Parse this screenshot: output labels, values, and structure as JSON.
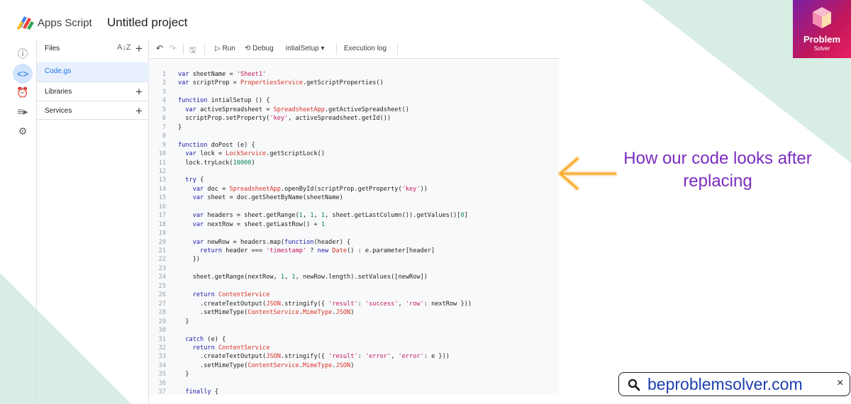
{
  "app": {
    "brand": "Apps Script",
    "project_title": "Untitled project"
  },
  "rail": {
    "icons": [
      "info-icon",
      "code-icon",
      "alarm-clock-icon",
      "executions-icon",
      "gear-icon"
    ],
    "glyphs": [
      "ⓘ",
      "<>",
      "⏰",
      "≡▸",
      "⚙"
    ]
  },
  "files_panel": {
    "title": "Files",
    "sort_glyph": "A͏Z",
    "add_glyph": "+",
    "current_file": "Code.gs",
    "sections": [
      "Libraries",
      "Services"
    ]
  },
  "toolbar": {
    "undo": "↶",
    "redo": "↷",
    "save": "🖫",
    "run": "▷ Run",
    "debug": "⟲ Debug",
    "function_select": "intialSetup",
    "execution_log": "Execution log"
  },
  "code": [
    {
      "n": "1",
      "html": "<span class=\"kw\">var</span> sheetName = <span class=\"str\">'Sheet1'</span>"
    },
    {
      "n": "2",
      "html": "<span class=\"kw\">var</span> scriptProp = <span class=\"cls\">PropertiesService</span>.getScriptProperties()"
    },
    {
      "n": "3",
      "html": ""
    },
    {
      "n": "4",
      "html": "<span class=\"kw\">function</span> intialSetup () {"
    },
    {
      "n": "5",
      "html": "  <span class=\"kw\">var</span> activeSpreadsheet = <span class=\"cls\">SpreadsheetApp</span>.getActiveSpreadsheet()"
    },
    {
      "n": "6",
      "html": "  scriptProp.setProperty(<span class=\"str\">'key'</span>, activeSpreadsheet.getId())"
    },
    {
      "n": "7",
      "html": "}"
    },
    {
      "n": "8",
      "html": ""
    },
    {
      "n": "9",
      "html": "<span class=\"kw\">function</span> doPost (e) {"
    },
    {
      "n": "10",
      "html": "  <span class=\"kw\">var</span> lock = <span class=\"cls\">LockService</span>.getScriptLock()"
    },
    {
      "n": "11",
      "html": "  lock.tryLock(<span class=\"num\">10000</span>)"
    },
    {
      "n": "12",
      "html": ""
    },
    {
      "n": "13",
      "html": "  <span class=\"kw\">try</span> {"
    },
    {
      "n": "14",
      "html": "    <span class=\"kw\">var</span> doc = <span class=\"cls\">SpreadsheetApp</span>.openById(scriptProp.getProperty(<span class=\"str\">'key'</span>))"
    },
    {
      "n": "15",
      "html": "    <span class=\"kw\">var</span> sheet = doc.getSheetByName(sheetName)"
    },
    {
      "n": "16",
      "html": ""
    },
    {
      "n": "17",
      "html": "    <span class=\"kw\">var</span> headers = sheet.getRange(<span class=\"num\">1</span>, <span class=\"num\">1</span>, <span class=\"num\">1</span>, sheet.getLastColumn()).getValues()[<span class=\"num\">0</span>]"
    },
    {
      "n": "18",
      "html": "    <span class=\"kw\">var</span> nextRow = sheet.getLastRow() + <span class=\"num\">1</span>"
    },
    {
      "n": "19",
      "html": ""
    },
    {
      "n": "20",
      "html": "    <span class=\"kw\">var</span> newRow = headers.map(<span class=\"kw\">function</span>(header) {"
    },
    {
      "n": "21",
      "html": "      <span class=\"kw\">return</span> header === <span class=\"str\">'timestamp'</span> ? <span class=\"kw\">new</span> <span class=\"cls\">Date</span>() : e.parameter[header]"
    },
    {
      "n": "22",
      "html": "    })"
    },
    {
      "n": "23",
      "html": ""
    },
    {
      "n": "24",
      "html": "    sheet.getRange(nextRow, <span class=\"num\">1</span>, <span class=\"num\">1</span>, newRow.length).setValues([newRow])"
    },
    {
      "n": "25",
      "html": ""
    },
    {
      "n": "26",
      "html": "    <span class=\"kw\">return</span> <span class=\"cls\">ContentService</span>"
    },
    {
      "n": "27",
      "html": "      .createTextOutput(<span class=\"cls\">JSON</span>.stringify({ <span class=\"str\">'result'</span>: <span class=\"str\">'success'</span>, <span class=\"str\">'row'</span>: nextRow }))"
    },
    {
      "n": "28",
      "html": "      .setMimeType(<span class=\"cls\">ContentService</span>.<span class=\"cls\">MimeType</span>.<span class=\"cls\">JSON</span>)"
    },
    {
      "n": "29",
      "html": "  }"
    },
    {
      "n": "30",
      "html": ""
    },
    {
      "n": "31",
      "html": "  <span class=\"kw\">catch</span> (e) {"
    },
    {
      "n": "32",
      "html": "    <span class=\"kw\">return</span> <span class=\"cls\">ContentService</span>"
    },
    {
      "n": "33",
      "html": "      .createTextOutput(<span class=\"cls\">JSON</span>.stringify({ <span class=\"str\">'result'</span>: <span class=\"str\">'error'</span>, <span class=\"str\">'error'</span>: e }))"
    },
    {
      "n": "34",
      "html": "      .setMimeType(<span class=\"cls\">ContentService</span>.<span class=\"cls\">MimeType</span>.<span class=\"cls\">JSON</span>)"
    },
    {
      "n": "35",
      "html": "  }"
    },
    {
      "n": "36",
      "html": ""
    },
    {
      "n": "37",
      "html": "  <span class=\"kw\">finally</span> {"
    }
  ],
  "annotation": {
    "text": "How our code looks after replacing",
    "color": "#7b2cbf",
    "arrow_color": "#f9a825"
  },
  "badge": {
    "name": "Problem",
    "sub": "Solver"
  },
  "urlbar": {
    "text": "beproblemsolver.com",
    "close": "×",
    "search_icon": "search-icon"
  }
}
